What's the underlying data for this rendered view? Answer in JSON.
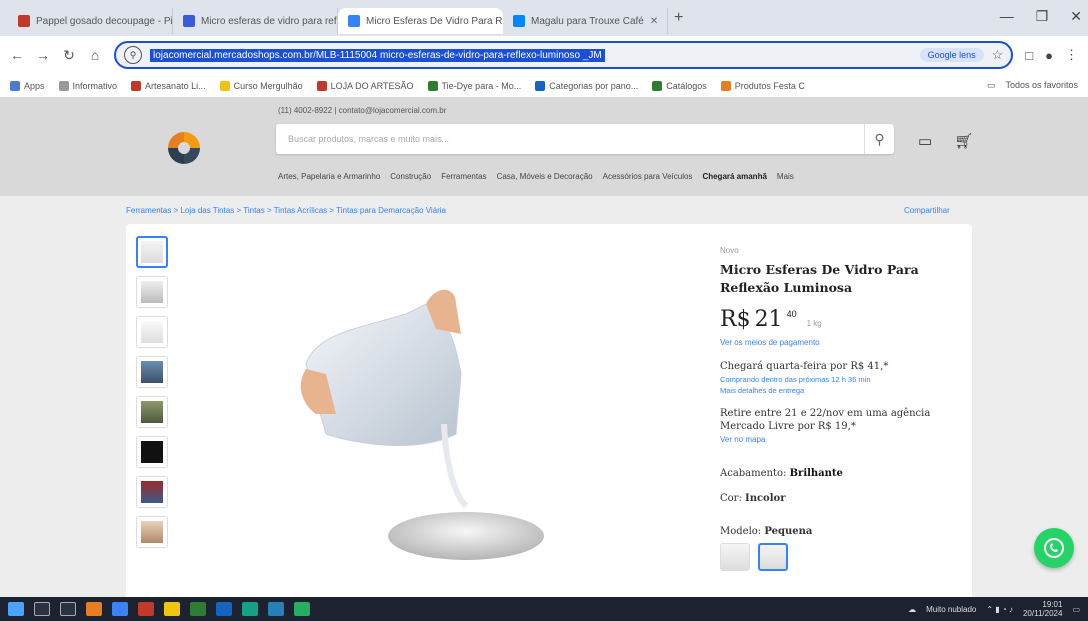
{
  "browser": {
    "tabs": [
      {
        "title": "Pappel gosado decoupage - Pin",
        "color": "#c0392b"
      },
      {
        "title": "Micro esferas de vidro para refl",
        "color": "#3b5bdb"
      },
      {
        "title": "Micro Esferas De Vidro Para Re",
        "color": "#3483fa",
        "active": true
      },
      {
        "title": "Magalu para Trouxe Café",
        "color": "#0086ff"
      }
    ],
    "url": "lojacomercial.mercadoshops.com.br/MLB-1115004 micro-esferas-de-vidro-para-reflexo-luminoso _JM",
    "google_lens": "Google lens",
    "bookmarks": [
      {
        "label": "Apps",
        "color": "#4a7bd0"
      },
      {
        "label": "Informativo",
        "color": "#999999"
      },
      {
        "label": "Artesanato Li...",
        "color": "#c0392b"
      },
      {
        "label": "Curso Mergulhão",
        "color": "#f1c40f"
      },
      {
        "label": "LOJA DO ARTESÃO",
        "color": "#c0392b"
      },
      {
        "label": "Tie-Dye para - Mo...",
        "color": "#2e7d32"
      },
      {
        "label": "Categorias por pano...",
        "color": "#1565c0"
      },
      {
        "label": "Catálogos",
        "color": "#2e7d32"
      },
      {
        "label": "Produtos Festa C",
        "color": "#e67e22"
      }
    ],
    "bookmarks_right": "Todos os favoritos"
  },
  "site": {
    "contact": "(11) 4002-8922 | contato@lojacomercial.com.br",
    "search_placeholder": "Buscar produtos, marcas e muito mais...",
    "categories": [
      "Artes, Papelaria e Armarinho",
      "Construção",
      "Ferramentas",
      "Casa, Móveis e Decoração",
      "Acessórios para Veículos"
    ],
    "categories_strong": "Chegará amanhã",
    "more": "Mais"
  },
  "breadcrumb": "Ferramentas > Loja das Tintas > Tintas > Tintas Acrílicas > Tintas para Demarcação Viária",
  "share": "Compartilhar",
  "product": {
    "condition": "Novo",
    "title": "Micro Esferas De Vidro Para Reflexão Luminosa",
    "currency": "R$",
    "amount": "21",
    "cents": "40",
    "unit_price": "1 kg",
    "payment_link": "Ver os meios de pagamento",
    "shipping": "Chegará quarta-feira por R$ 41,*",
    "shipping_sub": "Comprando dentro das próximas 12 h 36 min",
    "shipping_sub2": "Mais detalhes de entrega",
    "pickup": "Retire entre 21 e 22/nov em uma agência Mercado Livre por R$ 19,*",
    "pickup_link": "Ver no mapa",
    "finish_label": "Acabamento:",
    "finish_value": "Brilhante",
    "color_label": "Cor:",
    "color_value": "Incolor",
    "model_label": "Modelo:",
    "model_value": "Pequena"
  },
  "taskbar": {
    "weather": "Muito nublado",
    "time": "19:01",
    "date": "20/11/2024"
  },
  "colors": {
    "accent": "#3483fa",
    "whatsapp": "#25d366"
  }
}
